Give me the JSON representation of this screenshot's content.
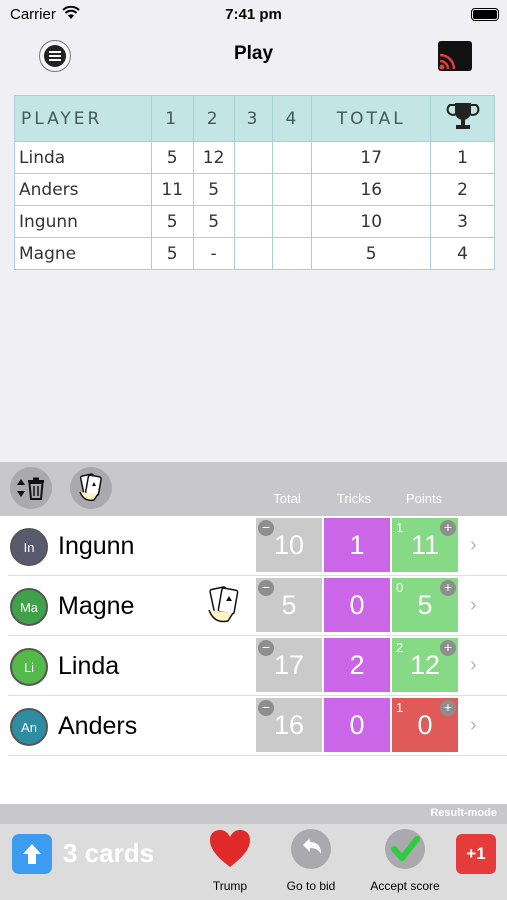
{
  "status": {
    "carrier": "Carrier",
    "time": "7:41 pm"
  },
  "nav": {
    "title": "Play"
  },
  "scoreboard": {
    "headers": [
      "PLAYER",
      "1",
      "2",
      "3",
      "4",
      "TOTAL"
    ],
    "rows": [
      {
        "player": "Linda",
        "r1": "5",
        "r2": "12",
        "r3": "",
        "r4": "",
        "total": "17",
        "rank": "1"
      },
      {
        "player": "Anders",
        "r1": "11",
        "r2": "5",
        "r3": "",
        "r4": "",
        "total": "16",
        "rank": "2"
      },
      {
        "player": "Ingunn",
        "r1": "5",
        "r2": "5",
        "r3": "",
        "r4": "",
        "total": "10",
        "rank": "3"
      },
      {
        "player": "Magne",
        "r1": "5",
        "r2": "-",
        "r3": "",
        "r4": "",
        "total": "5",
        "rank": "4"
      }
    ]
  },
  "panel": {
    "columns": {
      "total": "Total",
      "tricks": "Tricks",
      "points": "Points"
    },
    "players": [
      {
        "initials": "In",
        "name": "Ingunn",
        "total": "10",
        "tricks": "1",
        "bid": "1",
        "points": "11",
        "avatar_color": "#5a5a6e",
        "points_color": "#86d985"
      },
      {
        "initials": "Ma",
        "name": "Magne",
        "total": "5",
        "tricks": "0",
        "bid": "0",
        "points": "5",
        "avatar_color": "#3fa24a",
        "points_color": "#86d985"
      },
      {
        "initials": "Li",
        "name": "Linda",
        "total": "17",
        "tricks": "2",
        "bid": "2",
        "points": "12",
        "avatar_color": "#55b84a",
        "points_color": "#86d985"
      },
      {
        "initials": "An",
        "name": "Anders",
        "total": "16",
        "tricks": "0",
        "bid": "1",
        "points": "0",
        "avatar_color": "#2e8da0",
        "points_color": "#e05a5a"
      }
    ]
  },
  "footer": {
    "mode": "Result-mode",
    "cards": "3 cards",
    "trump": "Trump",
    "go_to_bid": "Go to bid",
    "accept_score": "Accept score",
    "plus_one": "+1"
  }
}
